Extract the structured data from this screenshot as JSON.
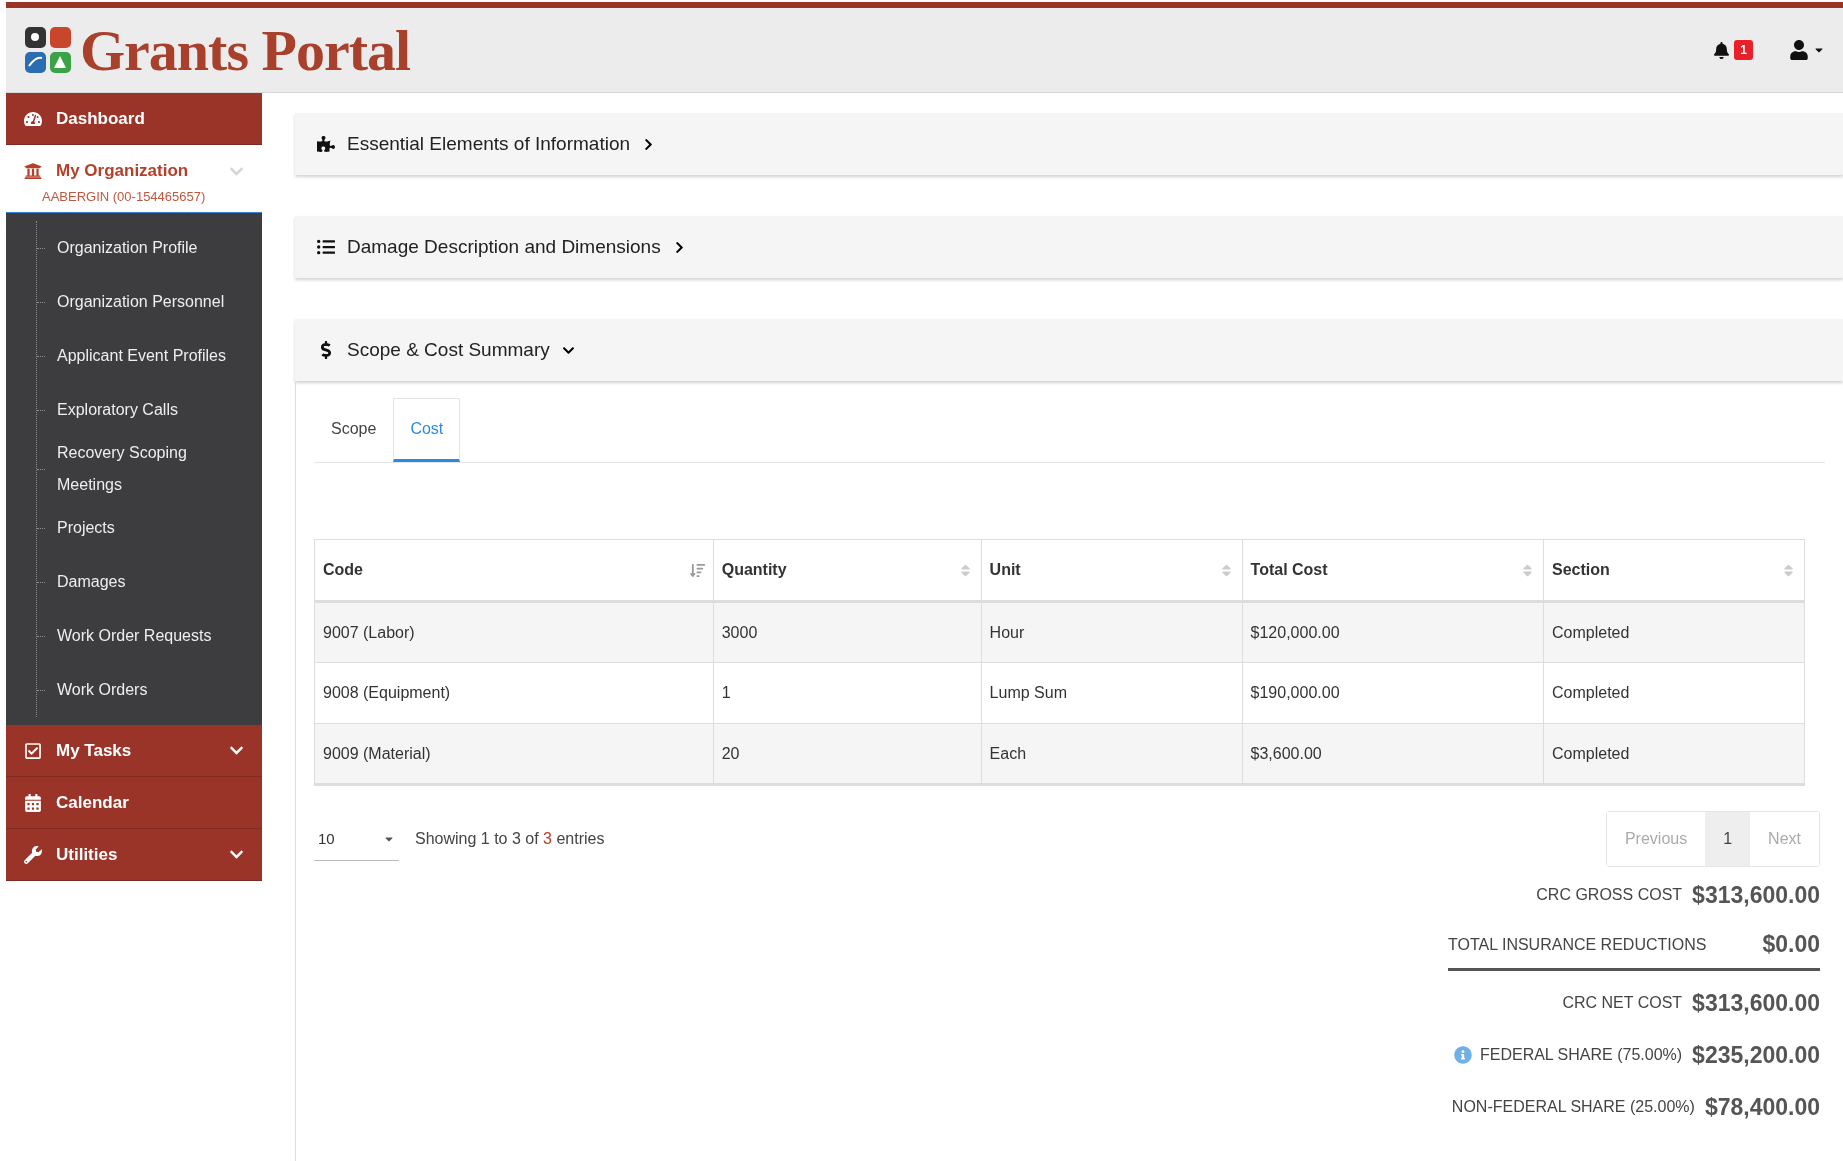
{
  "header": {
    "logo_text": "Grants Portal",
    "notification_count": "1"
  },
  "sidebar": {
    "items": [
      {
        "label": "Dashboard",
        "selected": false
      },
      {
        "label": "My Organization",
        "selected": true,
        "expanded": true,
        "subtitle": "AABERGIN (00-154465657)",
        "children": [
          {
            "label": "Organization Profile"
          },
          {
            "label": "Organization Personnel"
          },
          {
            "label": "Applicant Event Profiles"
          },
          {
            "label": "Exploratory Calls"
          },
          {
            "label": "Recovery Scoping Meetings"
          },
          {
            "label": "Projects"
          },
          {
            "label": "Damages"
          },
          {
            "label": "Work Order Requests"
          },
          {
            "label": "Work Orders"
          }
        ]
      },
      {
        "label": "My Tasks",
        "selected": false,
        "expanded": false
      },
      {
        "label": "Calendar",
        "selected": false
      },
      {
        "label": "Utilities",
        "selected": false,
        "expanded": false
      }
    ]
  },
  "panels": [
    {
      "title": "Essential Elements of Information",
      "expanded": false
    },
    {
      "title": "Damage Description and Dimensions",
      "expanded": false
    },
    {
      "title": "Scope & Cost Summary",
      "expanded": true
    }
  ],
  "tabs": [
    {
      "label": "Scope",
      "selected": false
    },
    {
      "label": "Cost",
      "selected": true
    }
  ],
  "table": {
    "columns": [
      {
        "label": "Code",
        "sorted": true
      },
      {
        "label": "Quantity",
        "sorted": false
      },
      {
        "label": "Unit",
        "sorted": false
      },
      {
        "label": "Total Cost",
        "sorted": false
      },
      {
        "label": "Section",
        "sorted": false
      }
    ],
    "rows": [
      [
        "9007 (Labor)",
        "3000",
        "Hour",
        "$120,000.00",
        "Completed"
      ],
      [
        "9008 (Equipment)",
        "1",
        "Lump Sum",
        "$190,000.00",
        "Completed"
      ],
      [
        "9009 (Material)",
        "20",
        "Each",
        "$3,600.00",
        "Completed"
      ]
    ]
  },
  "page_size": "10",
  "info": {
    "prefix": "Showing 1 to 3 of ",
    "total": "3",
    "suffix": " entries"
  },
  "pagination": {
    "previous": {
      "label": "Previous",
      "disabled": true
    },
    "pages": [
      {
        "label": "1",
        "selected": true
      }
    ],
    "next": {
      "label": "Next",
      "disabled": true
    }
  },
  "totals": [
    {
      "kind": "plain",
      "label": "CRC GROSS COST",
      "value": "$313,600.00"
    },
    {
      "kind": "divider",
      "label": "TOTAL INSURANCE REDUCTIONS",
      "value": "$0.00"
    },
    {
      "kind": "plain",
      "label": "CRC NET COST",
      "value": "$313,600.00"
    },
    {
      "kind": "info",
      "label": "FEDERAL SHARE (75.00%)",
      "value": "$235,200.00"
    },
    {
      "kind": "plain",
      "label": "NON-FEDERAL SHARE (25.00%)",
      "value": "$78,400.00"
    }
  ]
}
